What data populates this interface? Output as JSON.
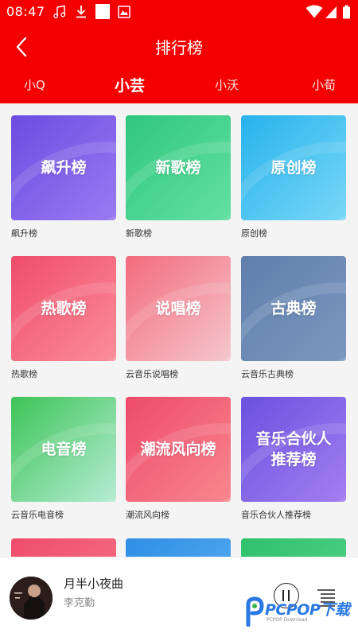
{
  "status": {
    "time": "08:47"
  },
  "header": {
    "title": "排行榜"
  },
  "tabs": [
    {
      "label": "小Q"
    },
    {
      "label": "小芸"
    },
    {
      "label": "小沃"
    },
    {
      "label": "小荀"
    }
  ],
  "charts": [
    {
      "cover_text": "飙升榜",
      "caption": "飙升榜",
      "colors": [
        "#6a4de0",
        "#9a7af2"
      ]
    },
    {
      "cover_text": "新歌榜",
      "caption": "新歌榜",
      "colors": [
        "#2fc77e",
        "#64e0a2"
      ]
    },
    {
      "cover_text": "原创榜",
      "caption": "原创榜",
      "colors": [
        "#27b3ec",
        "#79d7f7"
      ]
    },
    {
      "cover_text": "热歌榜",
      "caption": "热歌榜",
      "colors": [
        "#ef4d6a",
        "#fb8e9a"
      ]
    },
    {
      "cover_text": "说唱榜",
      "caption": "云音乐说唱榜",
      "colors": [
        "#f36b7c",
        "#f4c7cd"
      ]
    },
    {
      "cover_text": "古典榜",
      "caption": "云音乐古典榜",
      "colors": [
        "#5f7fab",
        "#7b97bf"
      ]
    },
    {
      "cover_text": "电音榜",
      "caption": "云音乐电音榜",
      "colors": [
        "#3dc457",
        "#b6ecd4"
      ]
    },
    {
      "cover_text": "潮流风向榜",
      "caption": "潮流风向榜",
      "colors": [
        "#ed4a6a",
        "#f9878f"
      ]
    },
    {
      "cover_text": "音乐合伙人\n推荐榜",
      "caption": "音乐合伙人推荐榜",
      "colors": [
        "#6a52df",
        "#a27ef1"
      ]
    },
    {
      "cover_text": "",
      "caption": "",
      "colors": [
        "#ef4d6a",
        "#f7778b"
      ]
    },
    {
      "cover_text": "",
      "caption": "",
      "colors": [
        "#2f8fe6",
        "#5cb0f0"
      ]
    },
    {
      "cover_text": "",
      "caption": "",
      "colors": [
        "#2fc06c",
        "#5ad58d"
      ]
    }
  ],
  "player": {
    "song": "月半小夜曲",
    "artist": "李克勤"
  },
  "watermark": {
    "brand": "PCPOP下载",
    "sub": "PCPOP Download"
  }
}
